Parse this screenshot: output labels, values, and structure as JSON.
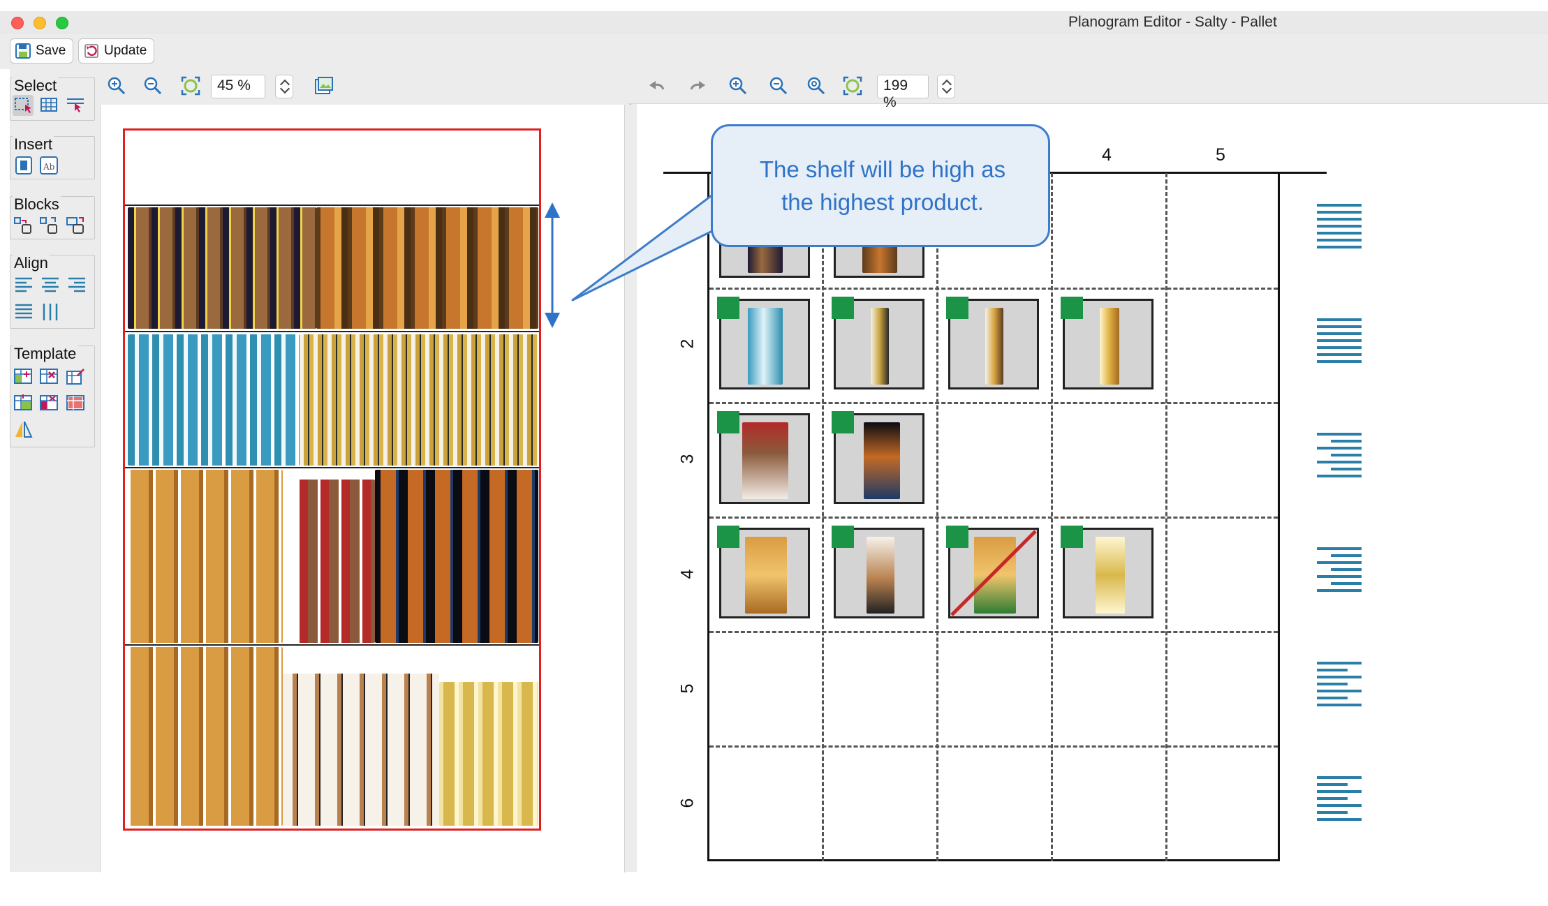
{
  "window": {
    "title": "Planogram Editor - Salty - Pallet"
  },
  "toolbar": {
    "save_label": "Save",
    "update_label": "Update"
  },
  "palette": {
    "select_title": "Select",
    "insert_title": "Insert",
    "blocks_title": "Blocks",
    "align_title": "Align",
    "template_title": "Template"
  },
  "left_view": {
    "zoom": "45 %"
  },
  "right_view": {
    "zoom": "199 %",
    "columns": [
      "4",
      "5"
    ],
    "rows": [
      "2",
      "3",
      "4",
      "5",
      "6"
    ]
  },
  "callout": {
    "line1": "The shelf will be high as",
    "line2": "the highest product."
  },
  "colors": {
    "accent": "#3d7cc9",
    "pallet_border": "#e02020",
    "slot_flag": "#1b9447",
    "align_icon": "#2a7fa8"
  }
}
